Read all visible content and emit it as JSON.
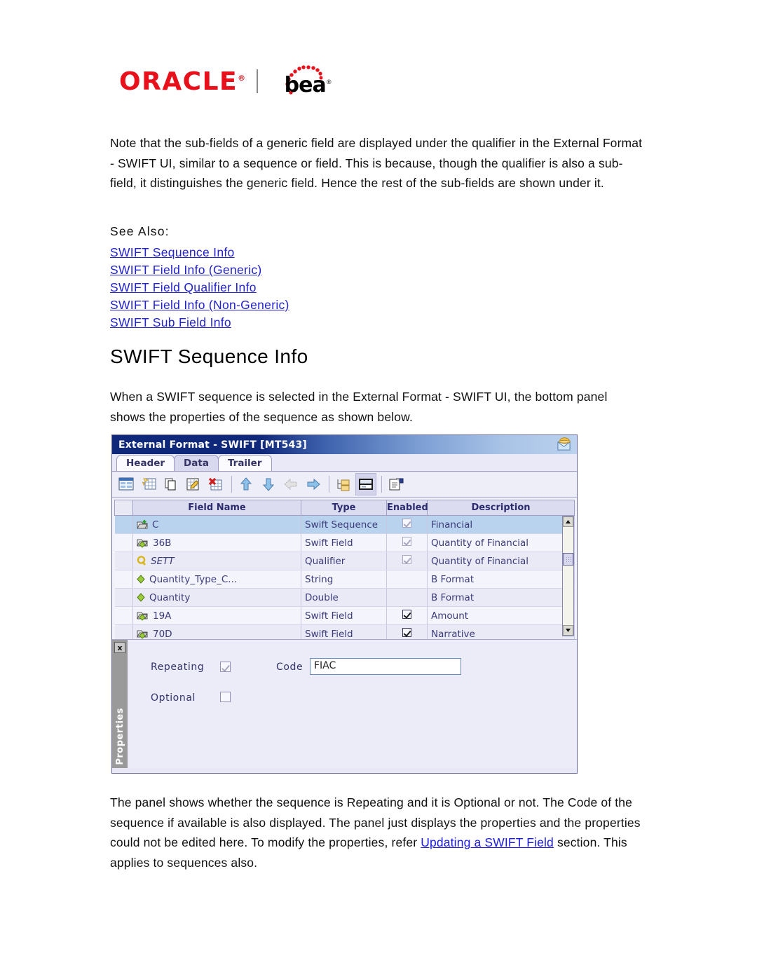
{
  "logo": {
    "oracle": "ORACLE",
    "oracle_reg": "®",
    "bea": "bea",
    "bea_reg": "®"
  },
  "content": {
    "intro_paragraph": "Note that the sub-fields of a generic field are displayed under the qualifier in the External Format - SWIFT UI, similar to a sequence or field. This is because, though the qualifier is also a sub-field, it distinguishes the generic field. Hence the rest of the sub-fields are shown under it.",
    "see_also_label": "See Also:",
    "see_also_links": [
      "SWIFT Sequence Info",
      "SWIFT Field Info (Generic)",
      "SWIFT Field Qualifier Info",
      "SWIFT Field Info (Non-Generic)",
      "SWIFT Sub Field Info"
    ],
    "heading": "SWIFT Sequence Info",
    "when_paragraph": "When a SWIFT sequence is selected in the External Format - SWIFT UI, the bottom panel shows the properties of the sequence as shown below.",
    "panel_paragraph_part1": "The panel shows whether the sequence is Repeating and it is Optional or not. The Code of the sequence if available is also displayed. The panel just displays the properties and the properties could not be edited here. To modify the properties, refer ",
    "panel_paragraph_link": "Updating a SWIFT Field",
    "panel_paragraph_part2": " section. This applies to sequences also."
  },
  "app_window": {
    "title": "External Format - SWIFT [MT543]",
    "title_icon": "envelope-icon",
    "tabs": [
      {
        "label": "Header",
        "active": false
      },
      {
        "label": "Data",
        "active": true
      },
      {
        "label": "Trailer",
        "active": false
      }
    ],
    "toolbar_icons": [
      "window-table-icon",
      "new-table-icon",
      "copy-icon",
      "edit-table-icon",
      "delete-table-icon",
      "move-up-icon",
      "move-down-icon",
      "move-left-icon",
      "move-right-icon",
      "tree-expand-icon",
      "properties-panel-icon",
      "settings-properties-icon"
    ],
    "table": {
      "columns": [
        "",
        "Field Name",
        "Type",
        "Enabled",
        "Description"
      ],
      "rows": [
        {
          "icon": "sequence-folder-add-icon",
          "indent": 0,
          "name": "C",
          "type": "Swift Sequence",
          "enabled": "checked-grey",
          "description": "Financial",
          "selected": true,
          "italic": false
        },
        {
          "icon": "swift-field-folder-icon",
          "indent": 1,
          "name": "36B",
          "type": "Swift Field",
          "enabled": "checked-grey",
          "description": "Quantity of Financial",
          "selected": false,
          "italic": false
        },
        {
          "icon": "qualifier-icon",
          "indent": 2,
          "name": "SETT",
          "type": "Qualifier",
          "enabled": "checked-grey",
          "description": "Quantity of Financial",
          "selected": false,
          "italic": true
        },
        {
          "icon": "sub-field-diamond-icon",
          "indent": 3,
          "name": "Quantity_Type_C...",
          "type": "String",
          "enabled": "none",
          "description": "B Format",
          "selected": false,
          "italic": false
        },
        {
          "icon": "sub-field-diamond-icon",
          "indent": 3,
          "name": "Quantity",
          "type": "Double",
          "enabled": "none",
          "description": "B Format",
          "selected": false,
          "italic": false
        },
        {
          "icon": "swift-field-folder-icon",
          "indent": 1,
          "name": "19A",
          "type": "Swift Field",
          "enabled": "checked-black",
          "description": "Amount",
          "selected": false,
          "italic": false
        },
        {
          "icon": "swift-field-folder-icon",
          "indent": 1,
          "name": "70D",
          "type": "Swift Field",
          "enabled": "checked-black",
          "description": "Narrative",
          "selected": false,
          "italic": false
        }
      ]
    },
    "properties_panel": {
      "tab_label": "Properties",
      "close_label": "x",
      "repeating_label": "Repeating",
      "repeating_checked": true,
      "optional_label": "Optional",
      "optional_checked": false,
      "code_label": "Code",
      "code_value": "FIAC"
    }
  },
  "colors": {
    "link": "#2323cc",
    "title_bar": "#10287a",
    "selected_row": "#b9d2ee",
    "oracle_red": "#e8101b"
  }
}
